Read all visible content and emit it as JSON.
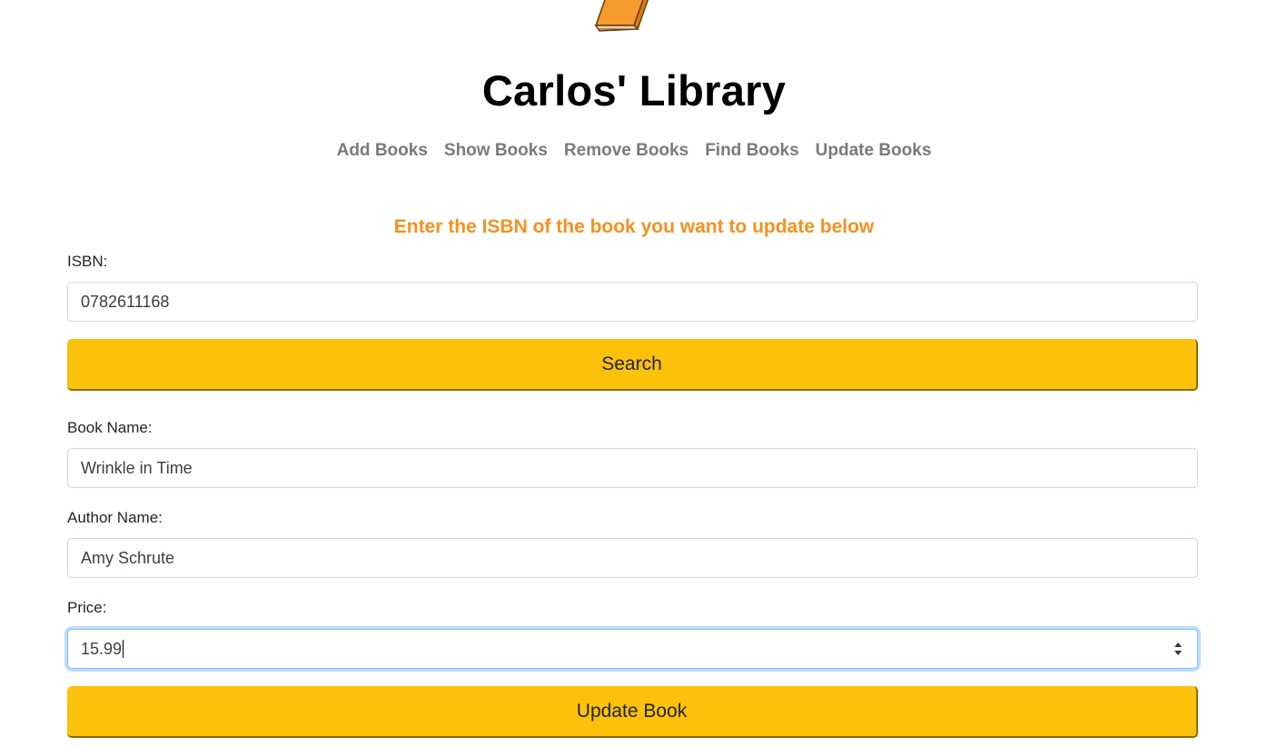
{
  "header": {
    "logo_icon": "book-icon",
    "title": "Carlos' Library"
  },
  "nav": {
    "items": [
      {
        "label": "Add Books"
      },
      {
        "label": "Show Books"
      },
      {
        "label": "Remove Books"
      },
      {
        "label": "Find Books"
      },
      {
        "label": "Update Books"
      }
    ]
  },
  "form": {
    "instruction": "Enter the ISBN of the book you want to update below",
    "isbn": {
      "label": "ISBN:",
      "value": "0782611168"
    },
    "search_button": "Search",
    "book_name": {
      "label": "Book Name:",
      "value": "Wrinkle in Time"
    },
    "author_name": {
      "label": "Author Name:",
      "value": "Amy Schrute"
    },
    "price": {
      "label": "Price:",
      "value": "15.99"
    },
    "update_button": "Update Book"
  },
  "colors": {
    "accent_orange": "#f7901e",
    "button_yellow": "#fbc10b",
    "nav_gray": "#7a7a7a"
  }
}
